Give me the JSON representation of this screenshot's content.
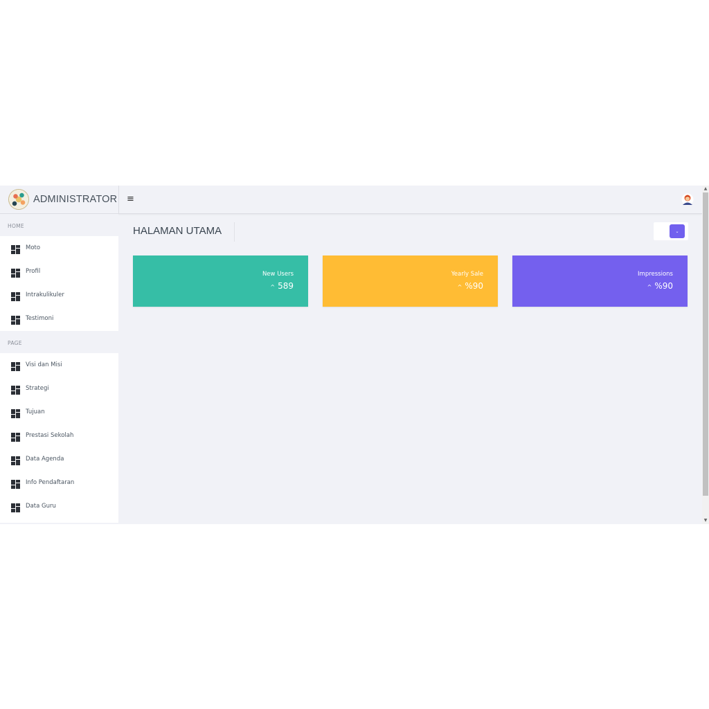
{
  "header": {
    "brand_name": "ADMINISTRATOR",
    "menu_toggle": "≡"
  },
  "sidebar": {
    "sections": [
      {
        "title": "HOME",
        "items": [
          {
            "label": "Moto"
          },
          {
            "label": "Profil"
          },
          {
            "label": "Intrakulikuler"
          },
          {
            "label": "Testimoni"
          }
        ]
      },
      {
        "title": "PAGE",
        "items": [
          {
            "label": "Visi dan Misi"
          },
          {
            "label": "Strategi"
          },
          {
            "label": "Tujuan"
          },
          {
            "label": "Prestasi Sekolah"
          },
          {
            "label": "Data Agenda"
          },
          {
            "label": "Info Pendaftaran"
          },
          {
            "label": "Data Guru"
          }
        ]
      }
    ]
  },
  "main": {
    "page_title": "HALAMAN UTAMA",
    "cards": [
      {
        "label": "New Users",
        "value": "589",
        "arrow": "^",
        "color": "#36bea6"
      },
      {
        "label": "Yearly Sale",
        "value": "%90",
        "arrow": "^",
        "color": "#ffbc34"
      },
      {
        "label": "Impressions",
        "value": "%90",
        "arrow": "^",
        "color": "#7460ee"
      }
    ]
  },
  "colors": {
    "accent": "#7160ee",
    "background": "#f1f2f7"
  }
}
